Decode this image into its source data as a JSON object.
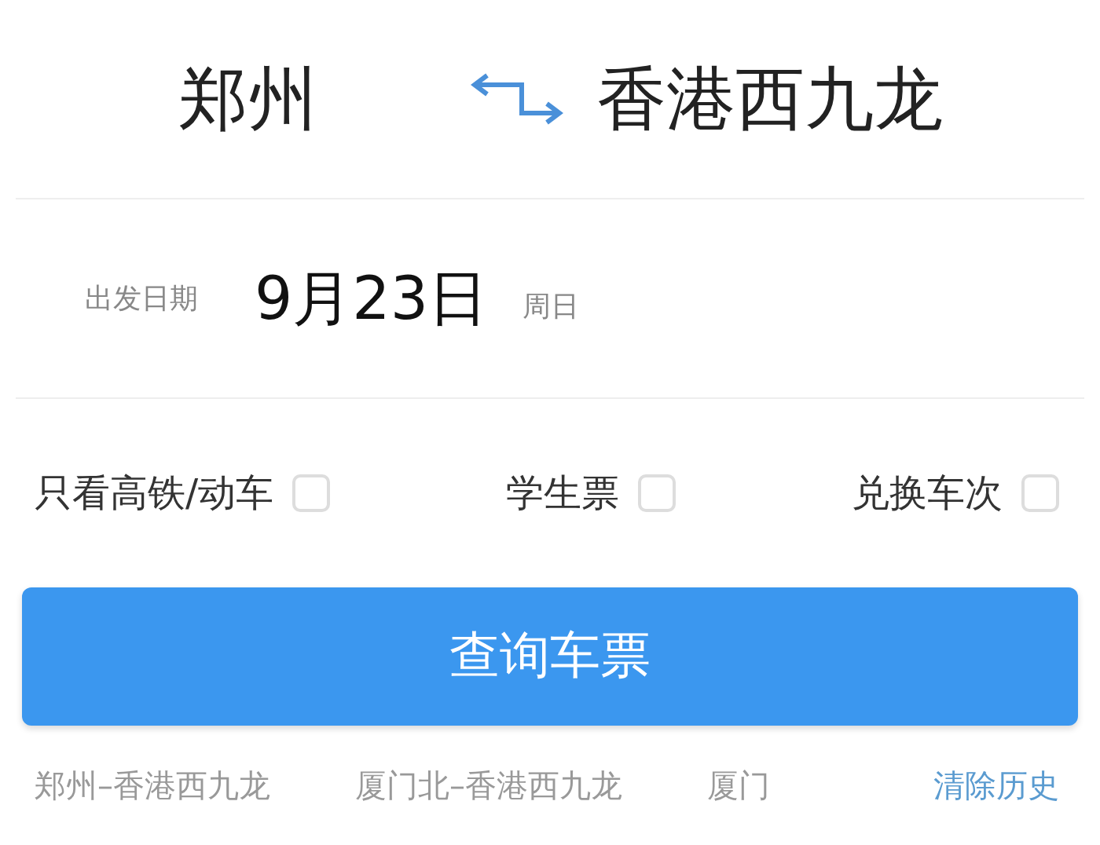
{
  "route": {
    "from": "郑州",
    "to": "香港西九龙"
  },
  "date": {
    "label": "出发日期",
    "value": "9月23日",
    "weekday": "周日"
  },
  "options": [
    {
      "label": "只看高铁/动车",
      "checked": false
    },
    {
      "label": "学生票",
      "checked": false
    },
    {
      "label": "兑换车次",
      "checked": false
    }
  ],
  "search_button": "查询车票",
  "history": [
    "郑州–香港西九龙",
    "厦门北–香港西九龙",
    "厦门"
  ],
  "clear_history": "清除历史"
}
